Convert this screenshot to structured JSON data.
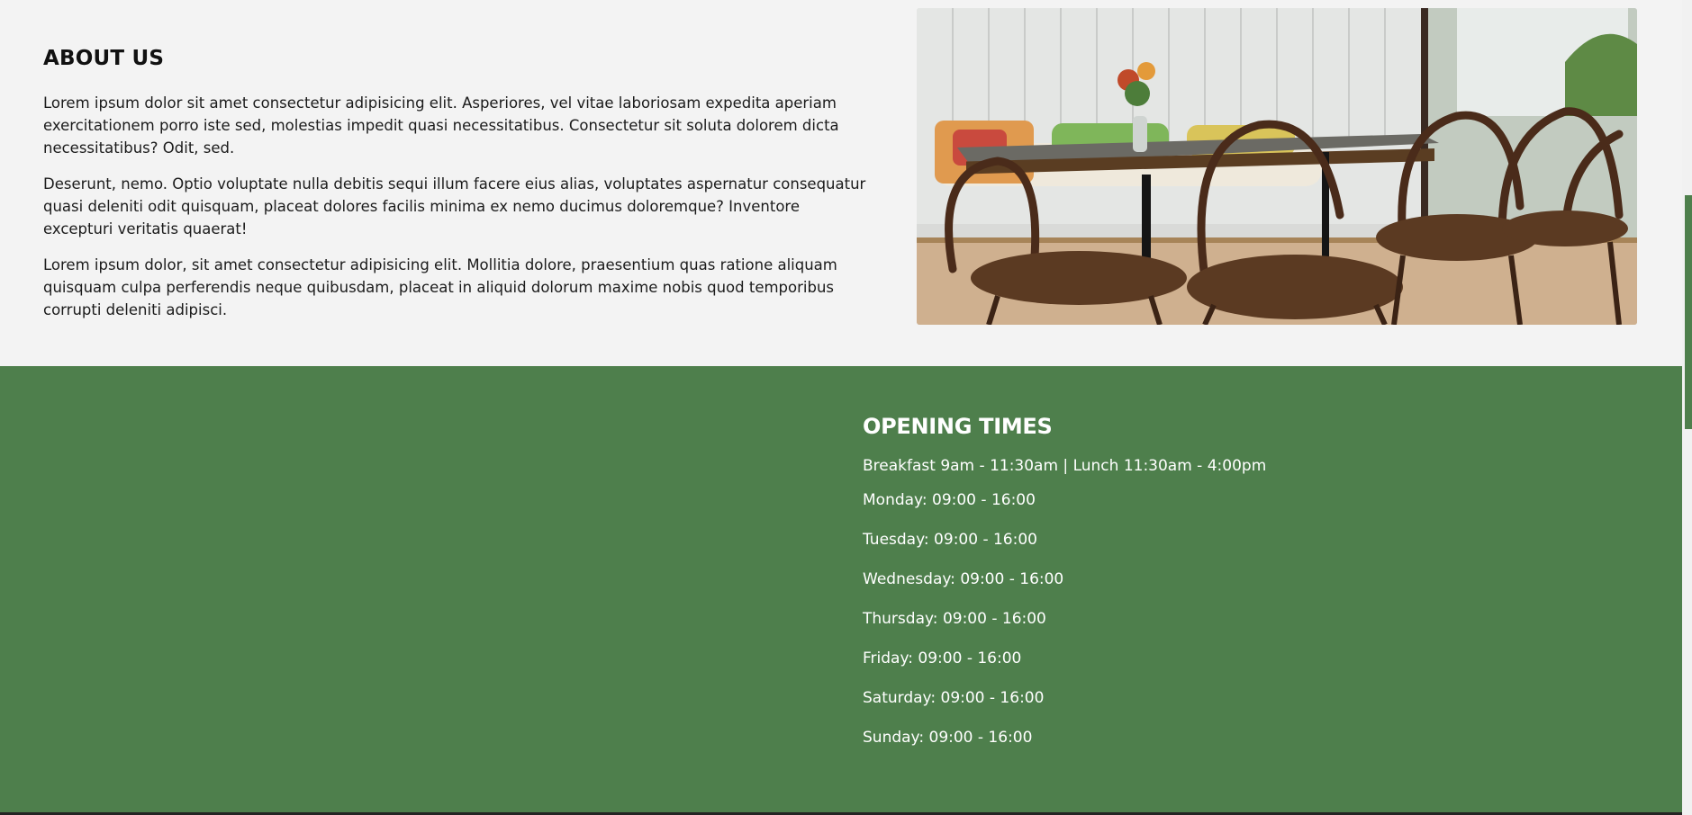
{
  "about": {
    "title": "ABOUT US",
    "paragraphs": [
      "Lorem ipsum dolor sit amet consectetur adipisicing elit. Asperiores, vel vitae laboriosam expedita aperiam exercitationem porro iste sed, molestias impedit quasi necessitatibus. Consectetur sit soluta dolorem dicta necessitatibus? Odit, sed.",
      "Deserunt, nemo. Optio voluptate nulla debitis sequi illum facere eius alias, voluptates aspernatur consequatur quasi deleniti odit quisquam, placeat dolores facilis minima ex nemo ducimus doloremque? Inventore excepturi veritatis quaerat!",
      "Lorem ipsum dolor, sit amet consectetur adipisicing elit. Mollitia dolore, praesentium quas ratione aliquam quisquam culpa perferendis neque quibusdam, placeat in aliquid dolorum maxime nobis quod temporibus corrupti deleniti adipisci."
    ]
  },
  "hours": {
    "title": "OPENING TIMES",
    "summary": "Breakfast 9am - 11:30am | Lunch 11:30am - 4:00pm",
    "days": [
      "Monday: 09:00 - 16:00",
      "Tuesday: 09:00 - 16:00",
      "Wednesday: 09:00 - 16:00",
      "Thursday: 09:00 - 16:00",
      "Friday: 09:00 - 16:00",
      "Saturday: 09:00 - 16:00",
      "Sunday: 09:00 - 16:00"
    ]
  },
  "colors": {
    "brand_green": "#4e7f4c",
    "section_bg": "#f3f3f3"
  }
}
